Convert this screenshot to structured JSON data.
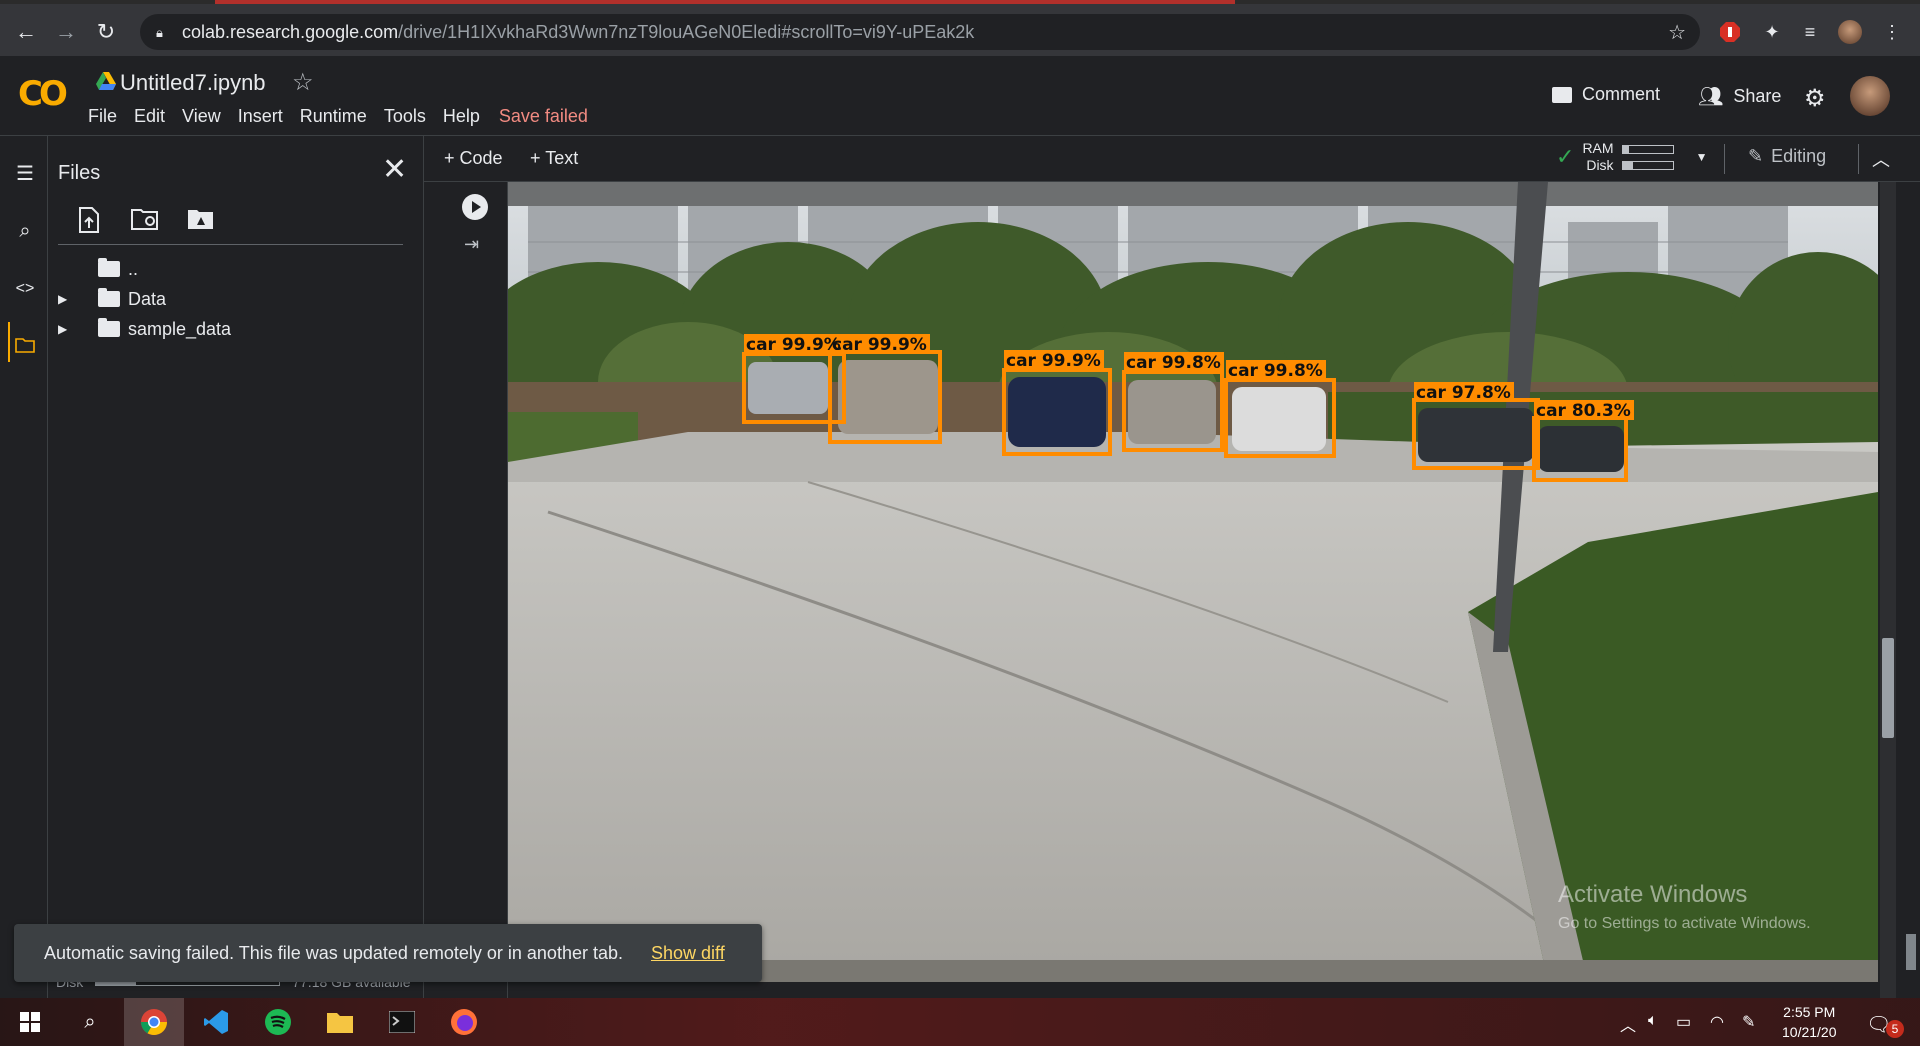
{
  "browser": {
    "url_host": "colab.research.google.com",
    "url_path": "/drive/1H1IXvkhaRd3Wwn7nzT9louAGeN0Eledi#scrollTo=vi9Y-uPEak2k"
  },
  "header": {
    "title": "Untitled7.ipynb",
    "menu": [
      "File",
      "Edit",
      "View",
      "Insert",
      "Runtime",
      "Tools",
      "Help"
    ],
    "save_status": "Save failed",
    "comment_label": "Comment",
    "share_label": "Share",
    "logo_text": "CO"
  },
  "files_panel": {
    "title": "Files",
    "tree": [
      {
        "label": ".."
      },
      {
        "label": "Data"
      },
      {
        "label": "sample_data"
      }
    ],
    "disk_label": "Disk",
    "disk_available": "77.18 GB available"
  },
  "toolbar": {
    "code_label": "Code",
    "text_label": "Text",
    "ram_label": "RAM",
    "disk_label": "Disk",
    "editing_label": "Editing"
  },
  "detections": [
    {
      "label": "car 99.9%"
    },
    {
      "label": "car 99.9%"
    },
    {
      "label": "car 99.9%"
    },
    {
      "label": "car 99.8%"
    },
    {
      "label": "car 99.8%"
    },
    {
      "label": "car 97.8%"
    },
    {
      "label": "car 80.3%"
    }
  ],
  "watermark": {
    "line1": "Activate Windows",
    "line2": "Go to Settings to activate Windows."
  },
  "toast": {
    "message": "Automatic saving failed. This file was updated remotely or in another tab.",
    "action": "Show diff"
  },
  "taskbar": {
    "time": "2:55 PM",
    "date": "10/21/20",
    "notification_count": "5"
  },
  "colors": {
    "accent_orange": "#ff8c00",
    "save_failed": "#f28b82",
    "show_diff": "#fdd663"
  }
}
